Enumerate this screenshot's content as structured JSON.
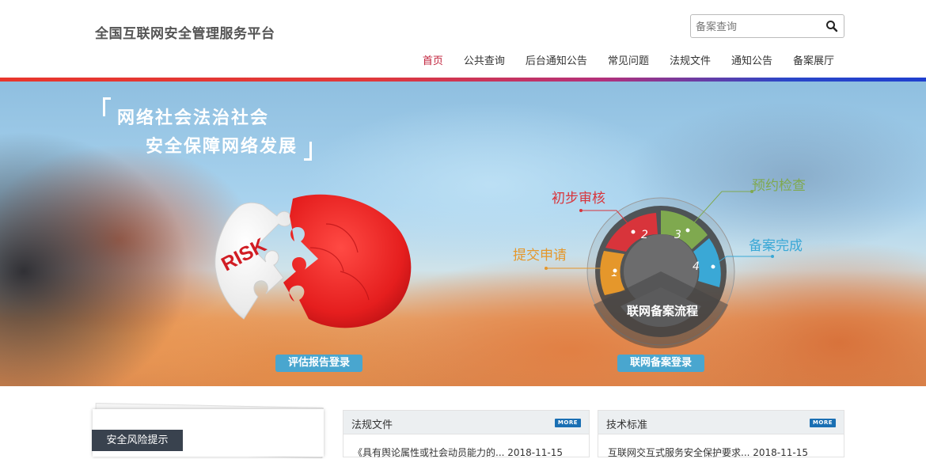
{
  "header": {
    "site_title": "全国互联网安全管理服务平台",
    "search": {
      "placeholder": "备案查询",
      "value": ""
    },
    "nav": [
      {
        "label": "首页",
        "active": true
      },
      {
        "label": "公共查询",
        "active": false
      },
      {
        "label": "后台通知公告",
        "active": false
      },
      {
        "label": "常见问题",
        "active": false
      },
      {
        "label": "法规文件",
        "active": false
      },
      {
        "label": "通知公告",
        "active": false
      },
      {
        "label": "备案展厅",
        "active": false
      }
    ]
  },
  "banner": {
    "slogan_line1": "网络社会法治社会",
    "slogan_line2": "安全保障网络发展",
    "puzzle_text": "RISK",
    "eval_login_button": "评估报告登录",
    "filing_login_button": "联网备案登录",
    "process": {
      "title": "联网备案流程",
      "steps": [
        {
          "number": "1",
          "label": "提交申请",
          "color": "#e5972b"
        },
        {
          "number": "2",
          "label": "初步审核",
          "color": "#d8343b"
        },
        {
          "number": "3",
          "label": "预约检查",
          "color": "#7fa94f"
        },
        {
          "number": "4",
          "label": "备案完成",
          "color": "#3aa8d6"
        }
      ]
    }
  },
  "lower": {
    "risk_tag": "安全风险提示",
    "panels": [
      {
        "title": "法规文件",
        "more": "MORE",
        "row": "《具有舆论属性或社会动员能力的... 2018-11-15"
      },
      {
        "title": "技术标准",
        "more": "MORE",
        "row": "互联网交互式服务安全保护要求... 2018-11-15"
      }
    ]
  },
  "colors": {
    "accent_red": "#c0203a",
    "button_blue": "#49a6cf",
    "more_blue": "#1a6fb3"
  }
}
